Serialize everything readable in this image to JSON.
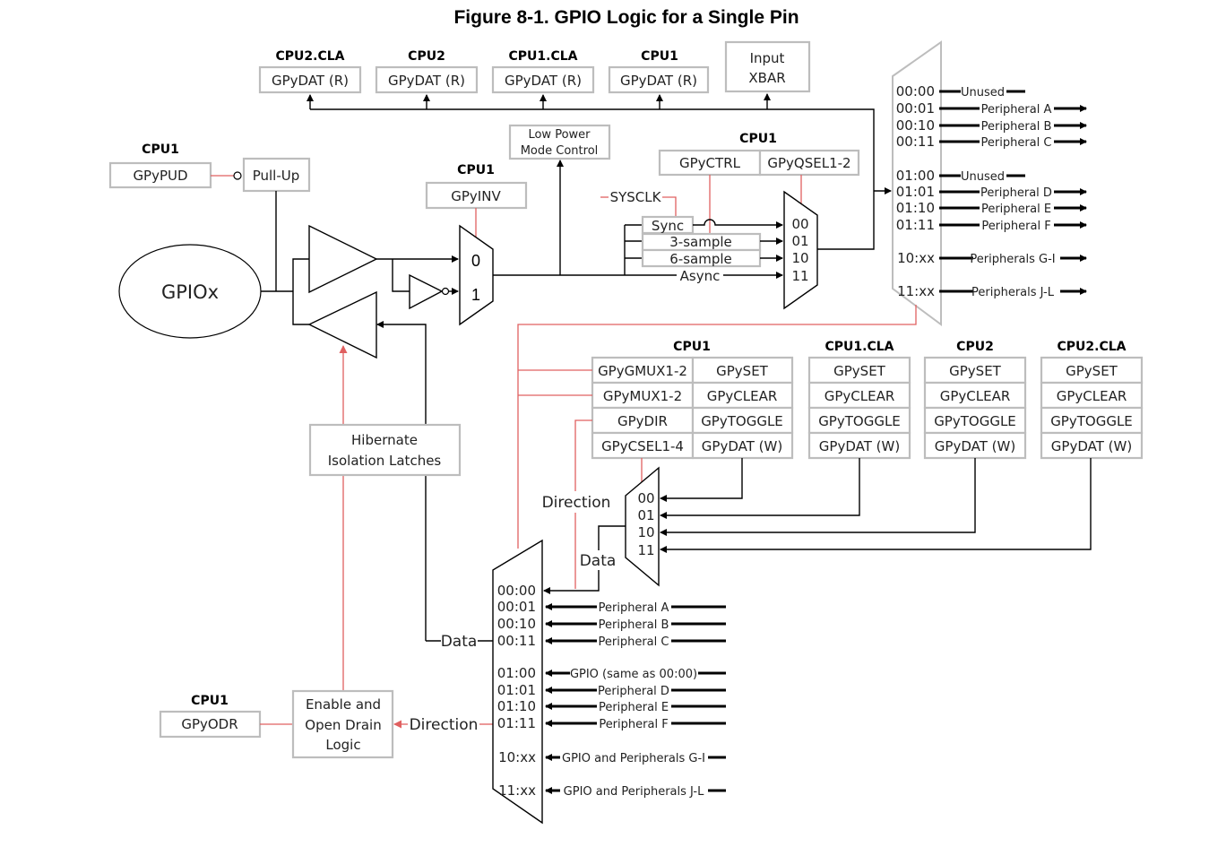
{
  "title": "Figure 8-1. GPIO Logic for a Single Pin",
  "pin": "GPIOx",
  "read_registers": [
    {
      "owner": "CPU2.CLA",
      "reg": "GPyDAT (R)"
    },
    {
      "owner": "CPU2",
      "reg": "GPyDAT (R)"
    },
    {
      "owner": "CPU1.CLA",
      "reg": "GPyDAT (R)"
    },
    {
      "owner": "CPU1",
      "reg": "GPyDAT (R)"
    }
  ],
  "input_xbar": [
    "Input",
    "XBAR"
  ],
  "pullup": {
    "owner": "CPU1",
    "reg": "GPyPUD",
    "block": "Pull-Up"
  },
  "inversion": {
    "owner": "CPU1",
    "reg": "GPyINV",
    "inputs": [
      "0",
      "1"
    ]
  },
  "low_power": [
    "Low Power",
    "Mode Control"
  ],
  "qualification": {
    "owner": "CPU1",
    "regs": [
      "GPyCTRL",
      "GPyQSEL1-2"
    ],
    "clock": "SYSCLK",
    "blocks": [
      "Sync",
      "3-sample",
      "6-sample",
      "Async"
    ],
    "inputs": [
      "00",
      "01",
      "10",
      "11"
    ]
  },
  "input_mux": {
    "rows": [
      {
        "sel": "00:00",
        "label": "Unused",
        "arrow": false
      },
      {
        "sel": "00:01",
        "label": "Peripheral A",
        "arrow": true
      },
      {
        "sel": "00:10",
        "label": "Peripheral B",
        "arrow": true
      },
      {
        "sel": "00:11",
        "label": "Peripheral C",
        "arrow": true
      },
      {
        "sel": "01:00",
        "label": "Unused",
        "arrow": false
      },
      {
        "sel": "01:01",
        "label": "Peripheral D",
        "arrow": true
      },
      {
        "sel": "01:10",
        "label": "Peripheral E",
        "arrow": true
      },
      {
        "sel": "01:11",
        "label": "Peripheral F",
        "arrow": true
      },
      {
        "sel": "10:xx",
        "label": "Peripherals G-I",
        "arrow": true
      },
      {
        "sel": "11:xx",
        "label": "Peripherals J-L",
        "arrow": true
      }
    ]
  },
  "cpu1_regs": {
    "owner": "CPU1",
    "left": [
      "GPyGMUX1-2",
      "GPyMUX1-2",
      "GPyDIR",
      "GPyCSEL1-4"
    ],
    "right": [
      "GPySET",
      "GPyCLEAR",
      "GPyTOGGLE",
      "GPyDAT (W)"
    ]
  },
  "write_regs": [
    {
      "owner": "CPU1.CLA",
      "regs": [
        "GPySET",
        "GPyCLEAR",
        "GPyTOGGLE",
        "GPyDAT (W)"
      ]
    },
    {
      "owner": "CPU2",
      "regs": [
        "GPySET",
        "GPyCLEAR",
        "GPyTOGGLE",
        "GPyDAT (W)"
      ]
    },
    {
      "owner": "CPU2.CLA",
      "regs": [
        "GPySET",
        "GPyCLEAR",
        "GPyTOGGLE",
        "GPyDAT (W)"
      ]
    }
  ],
  "core_mux": {
    "inputs": [
      "00",
      "01",
      "10",
      "11"
    ]
  },
  "labels": {
    "direction": "Direction",
    "data": "Data"
  },
  "hibernate": [
    "Hibernate",
    "Isolation Latches"
  ],
  "open_drain": {
    "owner": "CPU1",
    "reg": "GPyODR",
    "block": [
      "Enable and",
      "Open Drain",
      "Logic"
    ]
  },
  "output_mux": {
    "rows": [
      {
        "sel": "00:00",
        "label": ""
      },
      {
        "sel": "00:01",
        "label": "Peripheral A"
      },
      {
        "sel": "00:10",
        "label": "Peripheral B"
      },
      {
        "sel": "00:11",
        "label": "Peripheral C"
      },
      {
        "sel": "01:00",
        "label": "GPIO (same as 00:00)"
      },
      {
        "sel": "01:01",
        "label": "Peripheral D"
      },
      {
        "sel": "01:10",
        "label": "Peripheral E"
      },
      {
        "sel": "01:11",
        "label": "Peripheral F"
      },
      {
        "sel": "10:xx",
        "label": "GPIO and Peripherals G-I"
      },
      {
        "sel": "11:xx",
        "label": "GPIO and Peripherals J-L"
      }
    ]
  }
}
